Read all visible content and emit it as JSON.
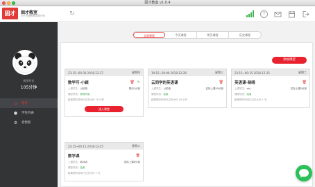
{
  "window": {
    "title": "固才教室 v1.0.4"
  },
  "brand": {
    "logo": "固才",
    "name": "固才教室",
    "subtitle": "GYT在线教育学苑分布"
  },
  "toolbar": {
    "refresh_icon": "refresh-icon",
    "icons": [
      "signal-icon",
      "help-icon",
      "message-icon",
      "calendar-icon",
      "logout-icon"
    ]
  },
  "user": {
    "label": "剩余时长",
    "minutes": "105分钟"
  },
  "sidebar": {
    "items": [
      {
        "label": "首页",
        "icon": "home-icon",
        "active": true
      },
      {
        "label": "学生列表",
        "icon": "person-icon",
        "active": false
      },
      {
        "label": "老帮新",
        "icon": "gear-icon",
        "active": false
      }
    ]
  },
  "tabs": [
    {
      "label": "全部课程",
      "active": true
    },
    {
      "label": "今天课程",
      "active": false
    },
    {
      "label": "明天课程",
      "active": false
    },
    {
      "label": "历史课程",
      "active": false
    }
  ],
  "add_button": "添加课堂",
  "cards": [
    {
      "time": "23:15~00:30  2018-12-27",
      "weekday": "星期四",
      "title": "数学可-小颖",
      "row1_label": "上课学生：",
      "row1_value": "以拍拍",
      "row1_right": "预约1分钟",
      "row2_label": "课堂状态：",
      "row2_value": "即将开始",
      "note": "距离预约时间已过去大约 16 小时",
      "enter": "进入课堂",
      "has_enter": true,
      "has_edit": true
    },
    {
      "time": "19:15~20:00  2018-12-26",
      "weekday": "星期三",
      "title": "云同学的英语课",
      "row1_label": "上课学生：",
      "row1_value": "以拍拍",
      "row1_right": "实际上课45分钟",
      "row2_label": "课堂状态：",
      "row2_value": "结束",
      "note": "距离预约时间已过去大约 16 小时",
      "enter": "",
      "has_enter": false,
      "has_edit": false
    },
    {
      "time": "23:15~00:15  2018-12-25",
      "weekday": "星期二",
      "title": "英语课-晓晴",
      "row1_label": "上课学生：",
      "row1_value": "abj",
      "row1_right": "实际上课0分钟",
      "row2_label": "课堂状态：",
      "row2_value": "结束",
      "note": "距离预约时间已过去大约 1 天",
      "enter": "",
      "has_enter": false,
      "has_edit": false
    },
    {
      "time": "23:15~00:15  2018-12-25",
      "weekday": "星期二",
      "title": "数学课",
      "row1_label": "上课学生：",
      "row1_value": "新冰冰",
      "row1_right": "实际上课8分钟",
      "row2_label": "课堂状态：",
      "row2_value": "结束",
      "note": "距离预约时间已过去大约 1 天",
      "enter": "",
      "has_enter": false,
      "has_edit": false
    }
  ],
  "colors": {
    "accent": "#e8232f",
    "sidebar_bg": "#333436",
    "success": "#3fa34d",
    "chat": "#2bc05a"
  },
  "chat_icon": "chat-bubble-icon"
}
